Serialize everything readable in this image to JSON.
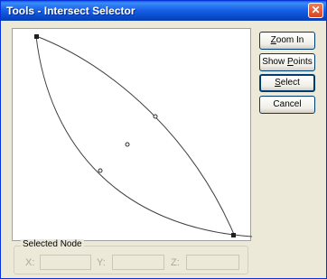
{
  "window": {
    "title": "Tools - Intersect Selector",
    "close_glyph": "✕"
  },
  "buttons": {
    "zoom_in": {
      "pre": "",
      "key": "Z",
      "post": "oom In"
    },
    "show_points": {
      "pre": "Show ",
      "key": "P",
      "post": "oints"
    },
    "select": {
      "pre": "",
      "key": "S",
      "post": "elect"
    },
    "cancel": {
      "pre": "Cancel",
      "key": "",
      "post": ""
    }
  },
  "selected_node": {
    "group_label": "Selected Node",
    "x_label": "X:",
    "y_label": "Y:",
    "z_label": "Z:",
    "x_value": "",
    "y_value": "",
    "z_value": ""
  }
}
